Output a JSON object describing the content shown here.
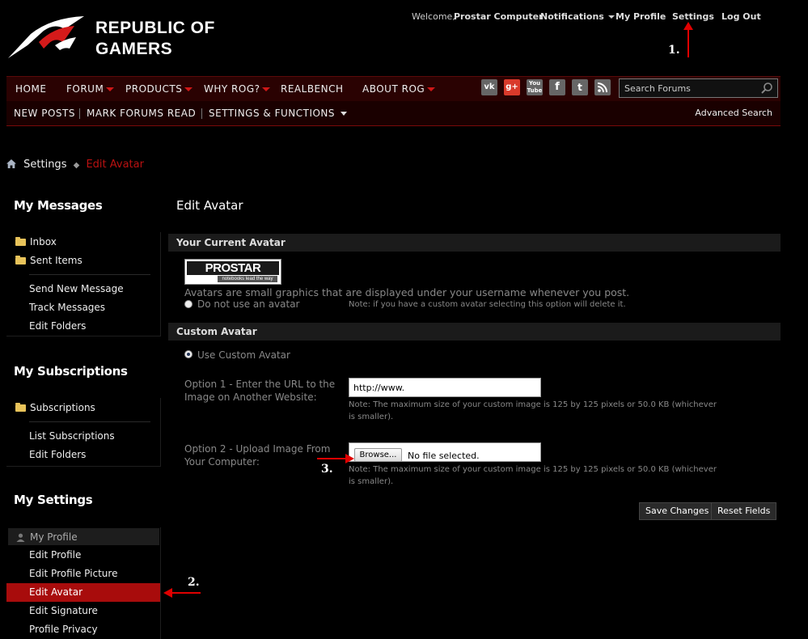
{
  "header": {
    "logo_line1": "REPUBLIC OF",
    "logo_line2": "GAMERS",
    "welcome": "Welcome,",
    "username": "Prostar Computer",
    "notifications": "Notifications",
    "my_profile": "My Profile",
    "settings": "Settings",
    "logout": "Log Out"
  },
  "annotations": {
    "a1": "1.",
    "a2": "2.",
    "a3": "3.",
    "arrow_color": "#e00000"
  },
  "nav": {
    "home": "HOME",
    "forum": "FORUM",
    "products": "PRODUCTS",
    "why_rog": "WHY ROG?",
    "realbench": "REALBENCH",
    "about_rog": "ABOUT ROG",
    "social": [
      "vk-icon",
      "google-plus-icon",
      "youtube-icon",
      "facebook-icon",
      "twitter-icon",
      "rss-icon"
    ],
    "search_placeholder": "Search Forums"
  },
  "subnav": {
    "new_posts": "NEW POSTS",
    "mark_read": "MARK FORUMS READ",
    "settings_functions": "SETTINGS & FUNCTIONS",
    "advanced_search": "Advanced Search"
  },
  "breadcrumb": {
    "parent": "Settings",
    "current": "Edit Avatar"
  },
  "sidebar": {
    "messages_title": "My Messages",
    "inbox": "Inbox",
    "sent": "Sent Items",
    "send_new": "Send New Message",
    "track": "Track Messages",
    "edit_folders": "Edit Folders",
    "subs_title": "My Subscriptions",
    "subscriptions": "Subscriptions",
    "list_subs": "List Subscriptions",
    "subs_edit_folders": "Edit Folders",
    "settings_title": "My Settings",
    "my_profile": "My Profile",
    "edit_profile": "Edit Profile",
    "edit_profile_picture": "Edit Profile Picture",
    "edit_avatar": "Edit Avatar",
    "edit_signature": "Edit Signature",
    "profile_privacy": "Profile Privacy"
  },
  "main": {
    "title": "Edit Avatar",
    "current_section": "Your Current Avatar",
    "avatar_logo_main": "PROSTAR",
    "avatar_logo_tag": "notebooks lead the way",
    "avatar_desc": "Avatars are small graphics that are displayed under your username whenever you post.",
    "no_avatar": "Do not use an avatar",
    "no_avatar_note": "Note: if you have a custom avatar selecting this option will delete it.",
    "custom_section": "Custom Avatar",
    "use_custom": "Use Custom Avatar",
    "opt1_line1": "Option 1 - Enter the URL to the",
    "opt1_line2": "Image on Another Website:",
    "url_value": "http://www.",
    "size_note_1": "Note: The maximum size of your custom image is 125 by 125 pixels or 50.0 KB (whichever",
    "size_note_2": "is smaller).",
    "opt2_line1": "Option 2 - Upload Image From",
    "opt2_line2": "Your Computer:",
    "browse": "Browse...",
    "no_file": "No file selected.",
    "save": "Save Changes",
    "reset": "Reset Fields"
  }
}
